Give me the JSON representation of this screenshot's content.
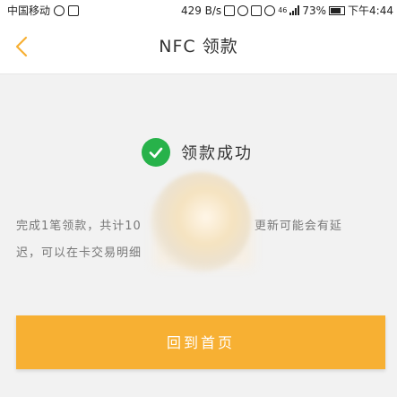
{
  "status_bar": {
    "carrier": "中国移动",
    "speed": "429 B/s",
    "network": "46",
    "battery": "73%",
    "time": "下午4:44"
  },
  "header": {
    "title": "NFC 领款"
  },
  "result": {
    "status_text": "领款成功",
    "description_line1_start": "完成1笔领款，共计10",
    "description_line1_end": "更新可能会有延",
    "description_line2": "迟，可以在卡交易明细"
  },
  "actions": {
    "home_label": "回到首页"
  },
  "colors": {
    "accent": "#f7b033",
    "success": "#27b24a"
  }
}
